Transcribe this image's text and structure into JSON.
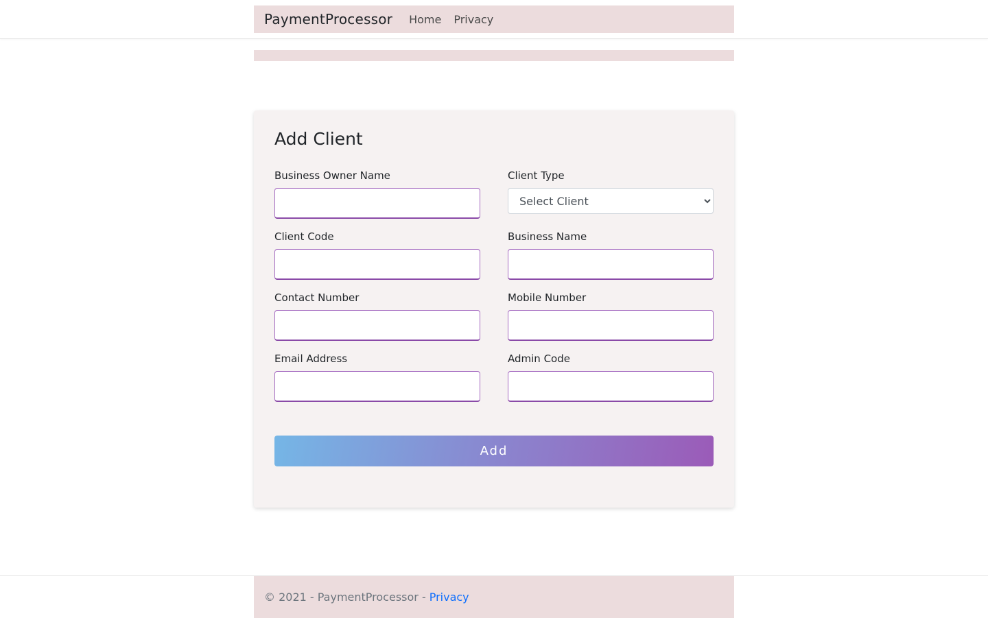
{
  "navbar": {
    "brand": "PaymentProcessor",
    "links": [
      {
        "label": "Home"
      },
      {
        "label": "Privacy"
      }
    ]
  },
  "form": {
    "title": "Add Client",
    "fields": {
      "business_owner_name": {
        "label": "Business Owner Name",
        "value": ""
      },
      "client_type": {
        "label": "Client Type",
        "selected": "Select Client"
      },
      "client_code": {
        "label": "Client Code",
        "value": ""
      },
      "business_name": {
        "label": "Business Name",
        "value": ""
      },
      "contact_number": {
        "label": "Contact Number",
        "value": ""
      },
      "mobile_number": {
        "label": "Mobile Number",
        "value": ""
      },
      "email_address": {
        "label": "Email Address",
        "value": ""
      },
      "admin_code": {
        "label": "Admin Code",
        "value": ""
      }
    },
    "submit_label": "Add"
  },
  "footer": {
    "copyright": "© 2021 - PaymentProcessor -",
    "privacy_link": "Privacy"
  },
  "colors": {
    "navbar_bg": "#ecdcdd",
    "card_bg": "#f6f2f2",
    "input_border": "#a46ac0",
    "button_gradient_start": "#75b6e6",
    "button_gradient_end": "#9b5bb8",
    "link": "#0d6efd"
  }
}
